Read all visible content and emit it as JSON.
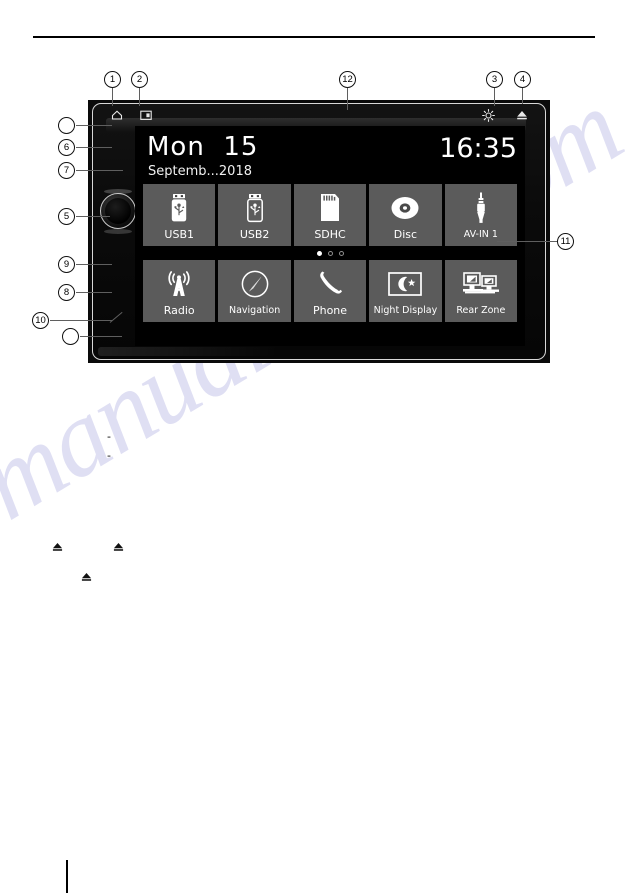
{
  "page": {
    "watermark_text": "manualshive.com",
    "has_top_rule": true,
    "has_bottom_tick": true
  },
  "device": {
    "name": "car-head-unit",
    "status_bar": {
      "left_icons": [
        {
          "name": "home-icon",
          "glyph": "home"
        },
        {
          "name": "display-mode-icon",
          "glyph": "screen"
        }
      ],
      "right_icons": [
        {
          "name": "brightness-icon",
          "glyph": "sun"
        },
        {
          "name": "eject-icon",
          "glyph": "eject"
        }
      ]
    },
    "knob": {
      "name": "volume-knob",
      "label": ""
    }
  },
  "screen": {
    "date_primary": "Mon  15",
    "date_secondary": "Septemb...2018",
    "time": "16:35",
    "page_dots": {
      "count": 3,
      "active_index": 0
    },
    "rows": [
      [
        {
          "label": "USB1",
          "icon": "usb-icon"
        },
        {
          "label": "USB2",
          "icon": "usb-icon"
        },
        {
          "label": "SDHC",
          "icon": "sd-card-icon"
        },
        {
          "label": "Disc",
          "icon": "disc-icon"
        },
        {
          "label": "AV-IN 1",
          "icon": "av-plug-icon"
        }
      ],
      [
        {
          "label": "Radio",
          "icon": "radio-tower-icon"
        },
        {
          "label": "Navigation",
          "icon": "compass-icon"
        },
        {
          "label": "Phone",
          "icon": "phone-handset-icon"
        },
        {
          "label": "Night Display",
          "icon": "moon-star-icon"
        },
        {
          "label": "Rear Zone",
          "icon": "dual-monitor-icon"
        }
      ]
    ]
  },
  "callouts": [
    {
      "id": "1",
      "label": "1"
    },
    {
      "id": "2",
      "label": "2"
    },
    {
      "id": "12",
      "label": "12"
    },
    {
      "id": "3",
      "label": "3"
    },
    {
      "id": "4",
      "label": "4"
    },
    {
      "id": "blank-top",
      "label": ""
    },
    {
      "id": "6",
      "label": "6"
    },
    {
      "id": "7",
      "label": "7"
    },
    {
      "id": "5",
      "label": "5"
    },
    {
      "id": "9",
      "label": "9"
    },
    {
      "id": "8",
      "label": "8"
    },
    {
      "id": "10",
      "label": "10"
    },
    {
      "id": "blank-bottom",
      "label": ""
    },
    {
      "id": "11",
      "label": "11"
    }
  ],
  "body_marks": {
    "dashes": [
      "-",
      "-"
    ],
    "eject_marks": 3
  },
  "colors": {
    "tile_bg": "#5b5b5b",
    "screen_bg": "#000000",
    "device_body": "#0a0a0a",
    "bezel_outline": "#d8d8d8",
    "text_on_screen": "#ffffff",
    "leader_line": "#5f5f5f",
    "watermark": "#9696d7"
  }
}
